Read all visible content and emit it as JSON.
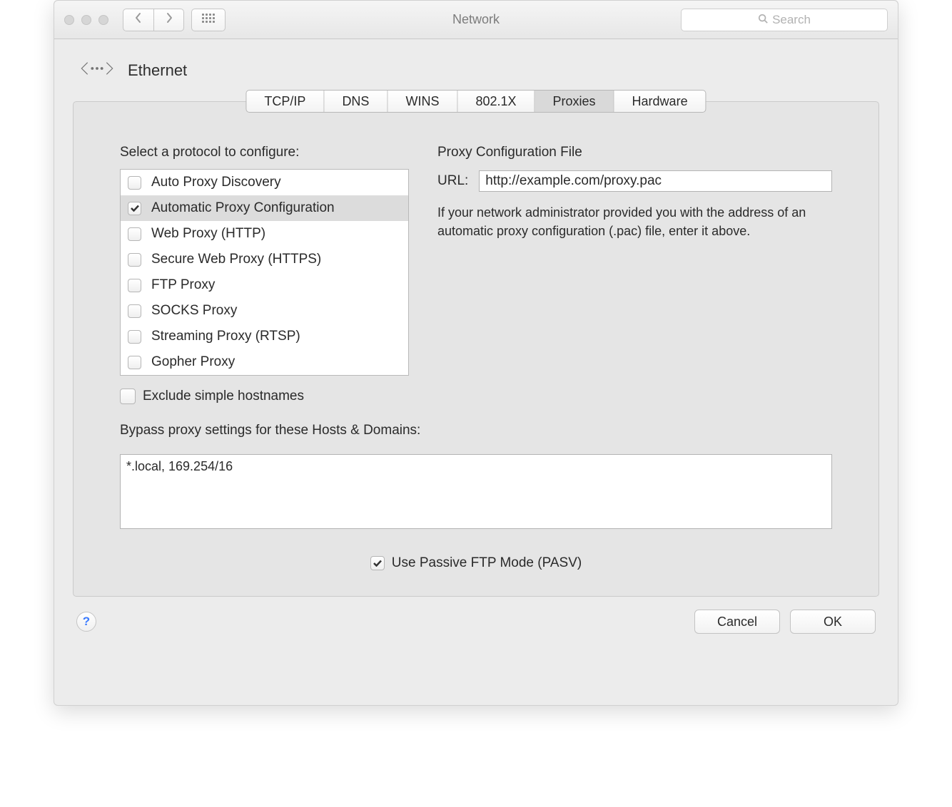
{
  "window_title": "Network",
  "search": {
    "placeholder": "Search"
  },
  "header": {
    "title": "Ethernet"
  },
  "tabs": [
    {
      "label": "TCP/IP"
    },
    {
      "label": "DNS"
    },
    {
      "label": "WINS"
    },
    {
      "label": "802.1X"
    },
    {
      "label": "Proxies"
    },
    {
      "label": "Hardware"
    }
  ],
  "active_tab_index": 4,
  "left": {
    "title": "Select a protocol to configure:",
    "items": [
      {
        "label": "Auto Proxy Discovery",
        "checked": false
      },
      {
        "label": "Automatic Proxy Configuration",
        "checked": true
      },
      {
        "label": "Web Proxy (HTTP)",
        "checked": false
      },
      {
        "label": "Secure Web Proxy (HTTPS)",
        "checked": false
      },
      {
        "label": "FTP Proxy",
        "checked": false
      },
      {
        "label": "SOCKS Proxy",
        "checked": false
      },
      {
        "label": "Streaming Proxy (RTSP)",
        "checked": false
      },
      {
        "label": "Gopher Proxy",
        "checked": false
      }
    ],
    "selected_index": 1,
    "exclude_label": "Exclude simple hostnames",
    "exclude_checked": false
  },
  "right": {
    "title": "Proxy Configuration File",
    "url_label": "URL:",
    "url_value": "http://example.com/proxy.pac",
    "description": "If your network administrator provided you with the address of an automatic proxy configuration (.pac) file, enter it above."
  },
  "bypass": {
    "title": "Bypass proxy settings for these Hosts & Domains:",
    "value": "*.local, 169.254/16"
  },
  "pasv": {
    "label": "Use Passive FTP Mode (PASV)",
    "checked": true
  },
  "buttons": {
    "help": "?",
    "cancel": "Cancel",
    "ok": "OK"
  }
}
